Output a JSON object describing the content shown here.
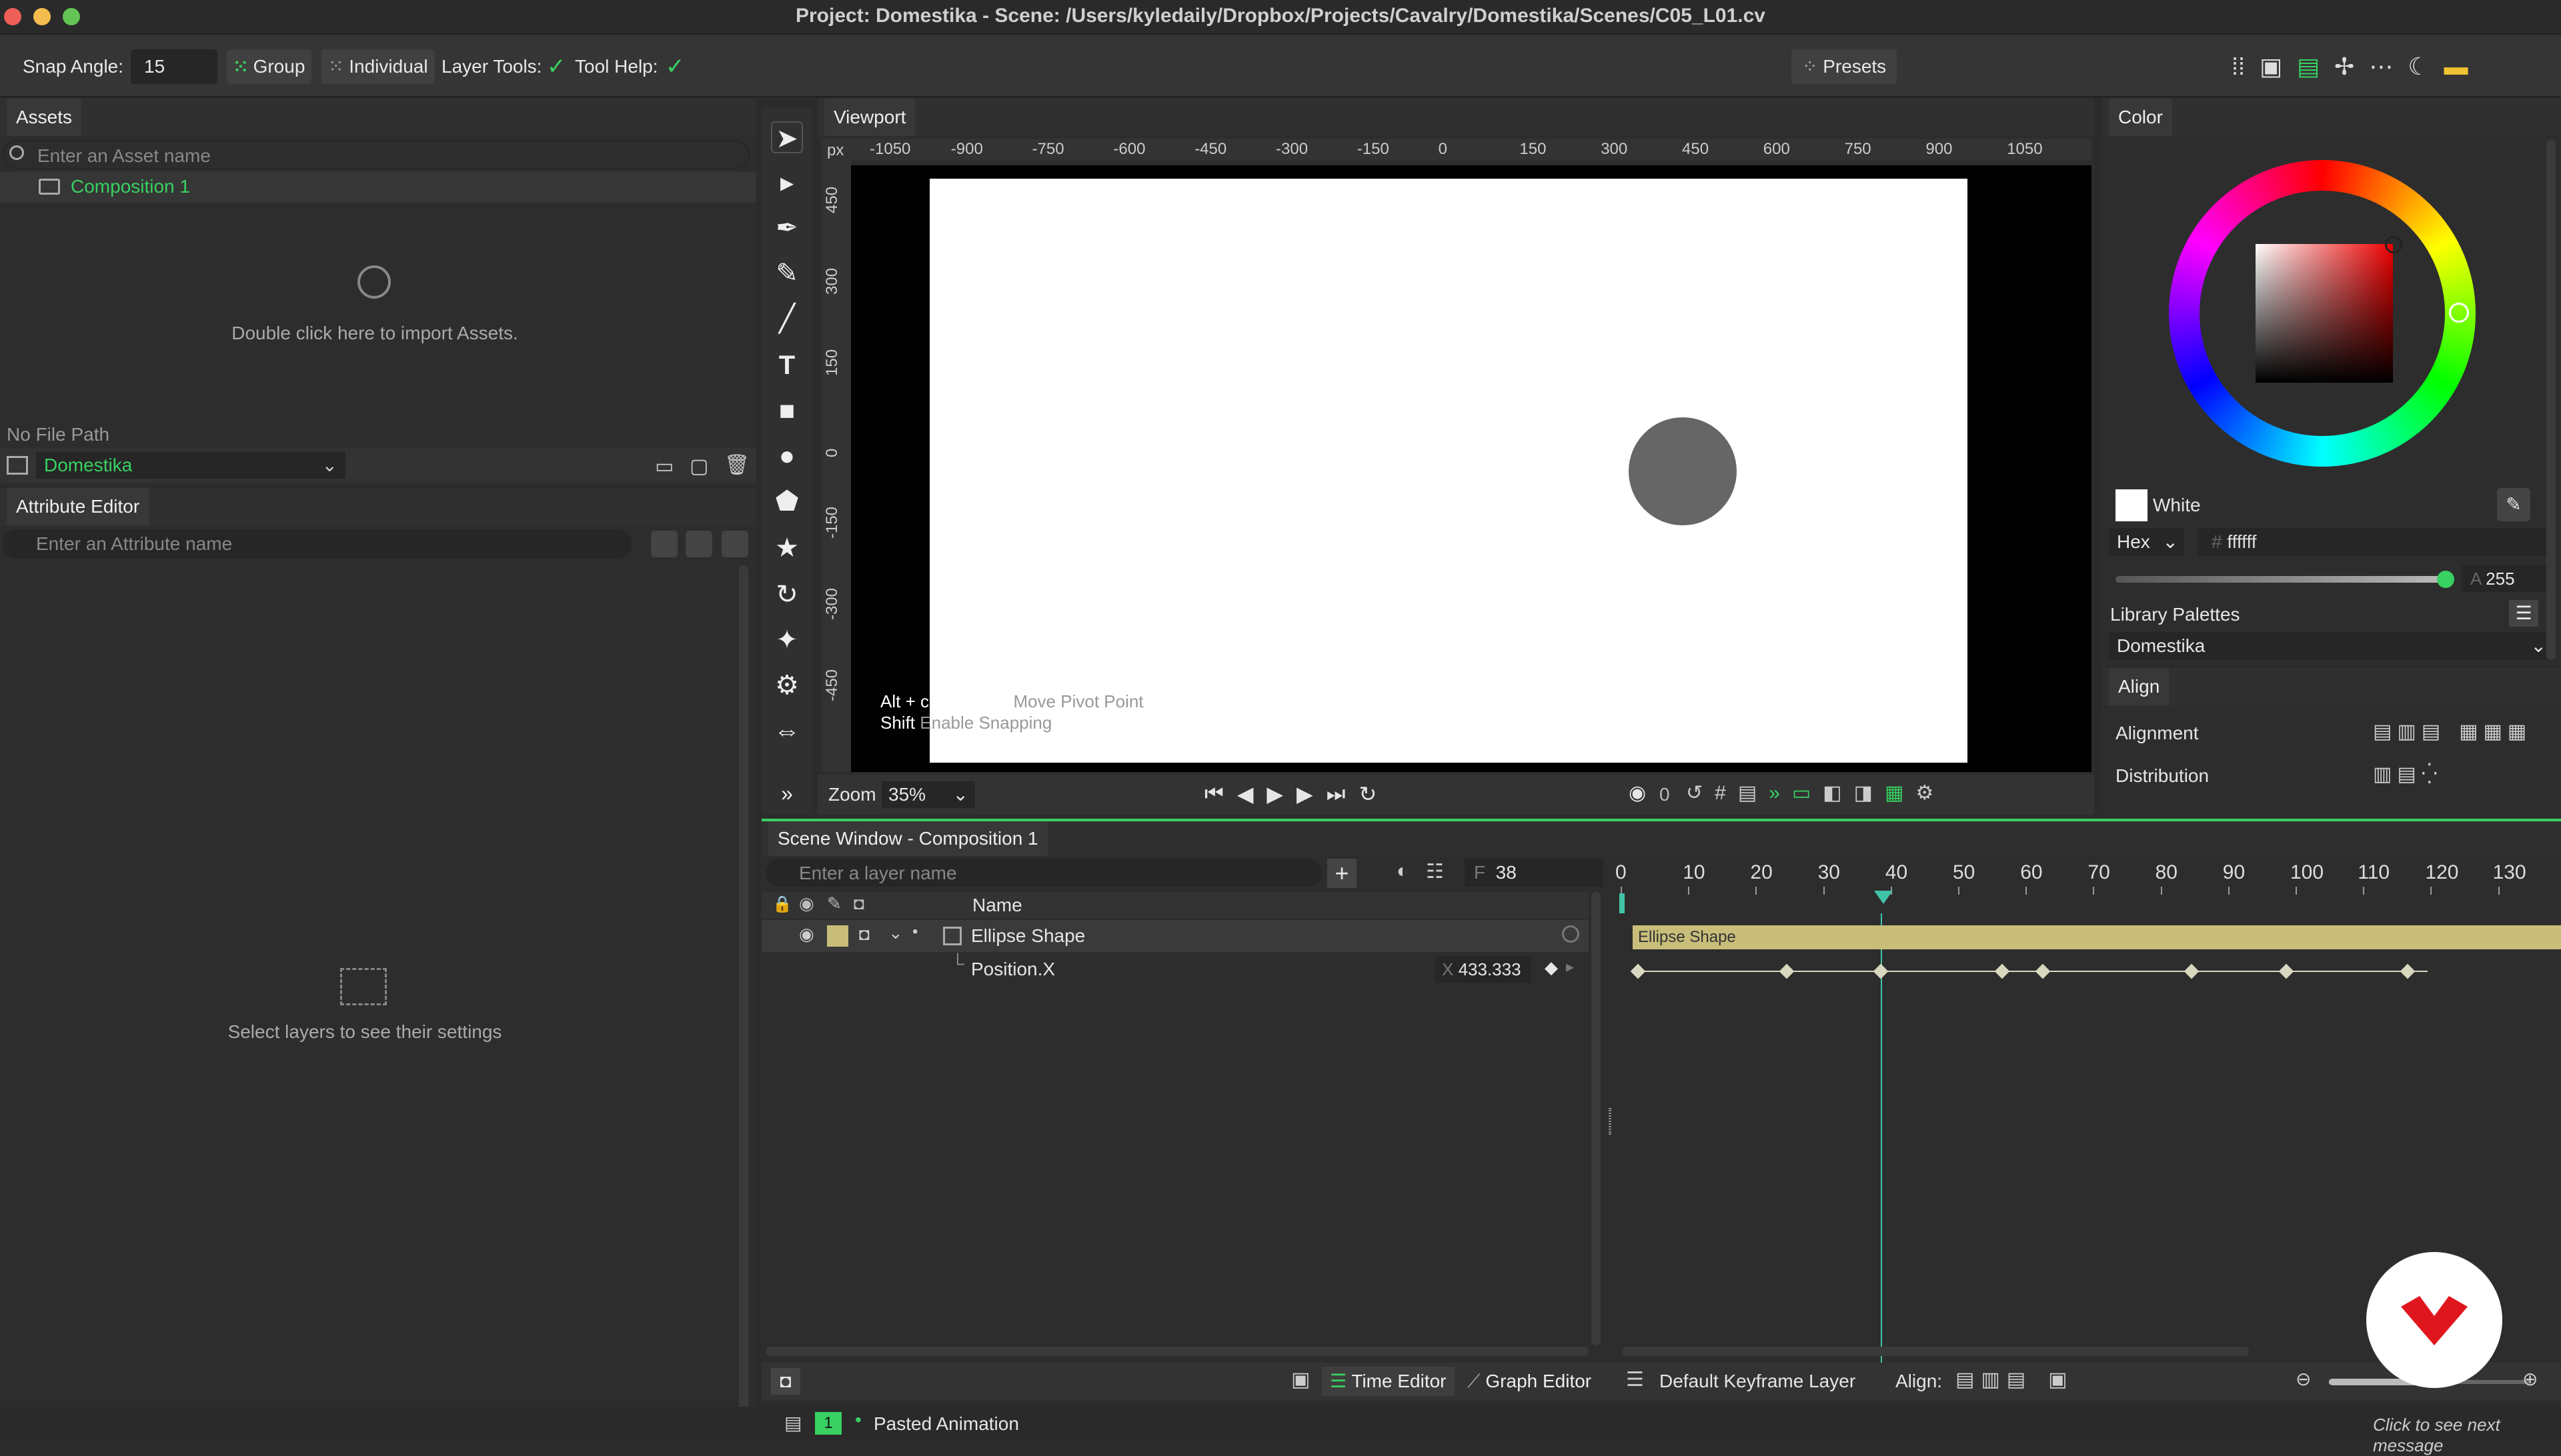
{
  "window": {
    "title": "Project: Domestika - Scene: /Users/kyledaily/Dropbox/Projects/Cavalry/Domestika/Scenes/C05_L01.cv"
  },
  "toolbar": {
    "snap_label": "Snap Angle:",
    "snap_value": "15",
    "group_label": "Group",
    "individual_label": "Individual",
    "layer_tools_label": "Layer Tools:",
    "tool_help_label": "Tool Help:",
    "presets_label": "Presets"
  },
  "assets": {
    "tab": "Assets",
    "search_placeholder": "Enter an Asset name",
    "items": [
      "Composition 1"
    ],
    "import_hint": "Double click here to import Assets.",
    "file_path": "No File Path",
    "project": "Domestika"
  },
  "attribute_editor": {
    "tab": "Attribute Editor",
    "search_placeholder": "Enter an Attribute name",
    "hint": "Select layers to see their settings"
  },
  "viewport": {
    "tab": "Viewport",
    "unit": "px",
    "h_ticks": [
      "-1050",
      "-900",
      "-750",
      "-600",
      "-450",
      "-300",
      "-150",
      "0",
      "150",
      "300",
      "450",
      "600",
      "750",
      "900",
      "1050"
    ],
    "v_ticks": [
      "450",
      "300",
      "150",
      "0",
      "-150",
      "-300",
      "-450"
    ],
    "help_line1_key": "Alt + click + drag",
    "help_line1_desc": "Move Pivot Point",
    "help_line2_key": "Shift",
    "help_line2_desc": "Enable Snapping",
    "zoom_label": "Zoom",
    "zoom_value": "35%",
    "frame_zero": "0"
  },
  "color": {
    "tab": "Color",
    "swatch_name": "White",
    "mode": "Hex",
    "hex_value": "ffffff",
    "alpha_label": "A",
    "alpha_value": "255",
    "library_label": "Library Palettes",
    "palette": "Domestika"
  },
  "align": {
    "tab": "Align",
    "alignment_label": "Alignment",
    "distribution_label": "Distribution"
  },
  "scene": {
    "tab": "Scene Window - Composition 1",
    "search_placeholder": "Enter a layer name",
    "frame_label": "F",
    "frame_value": "38",
    "name_header": "Name",
    "layer_name": "Ellipse Shape",
    "attr_name": "Position.X",
    "attr_axis": "X",
    "attr_value": "433.333",
    "timeline_ticks": [
      "0",
      "10",
      "20",
      "30",
      "40",
      "50",
      "60",
      "70",
      "80",
      "90",
      "100",
      "110",
      "120",
      "130"
    ],
    "clip_label": "Ellipse Shape",
    "time_editor": "Time Editor",
    "graph_editor": "Graph Editor",
    "keyframe_layer": "Default Keyframe Layer",
    "align_label": "Align:"
  },
  "status": {
    "count": "1",
    "message": "Pasted Animation",
    "next_message": "Click to see next message"
  },
  "colors": {
    "accent": "#38d162",
    "clip": "#c8be7a",
    "playhead": "#3fc4a8",
    "circle": "#666666"
  }
}
